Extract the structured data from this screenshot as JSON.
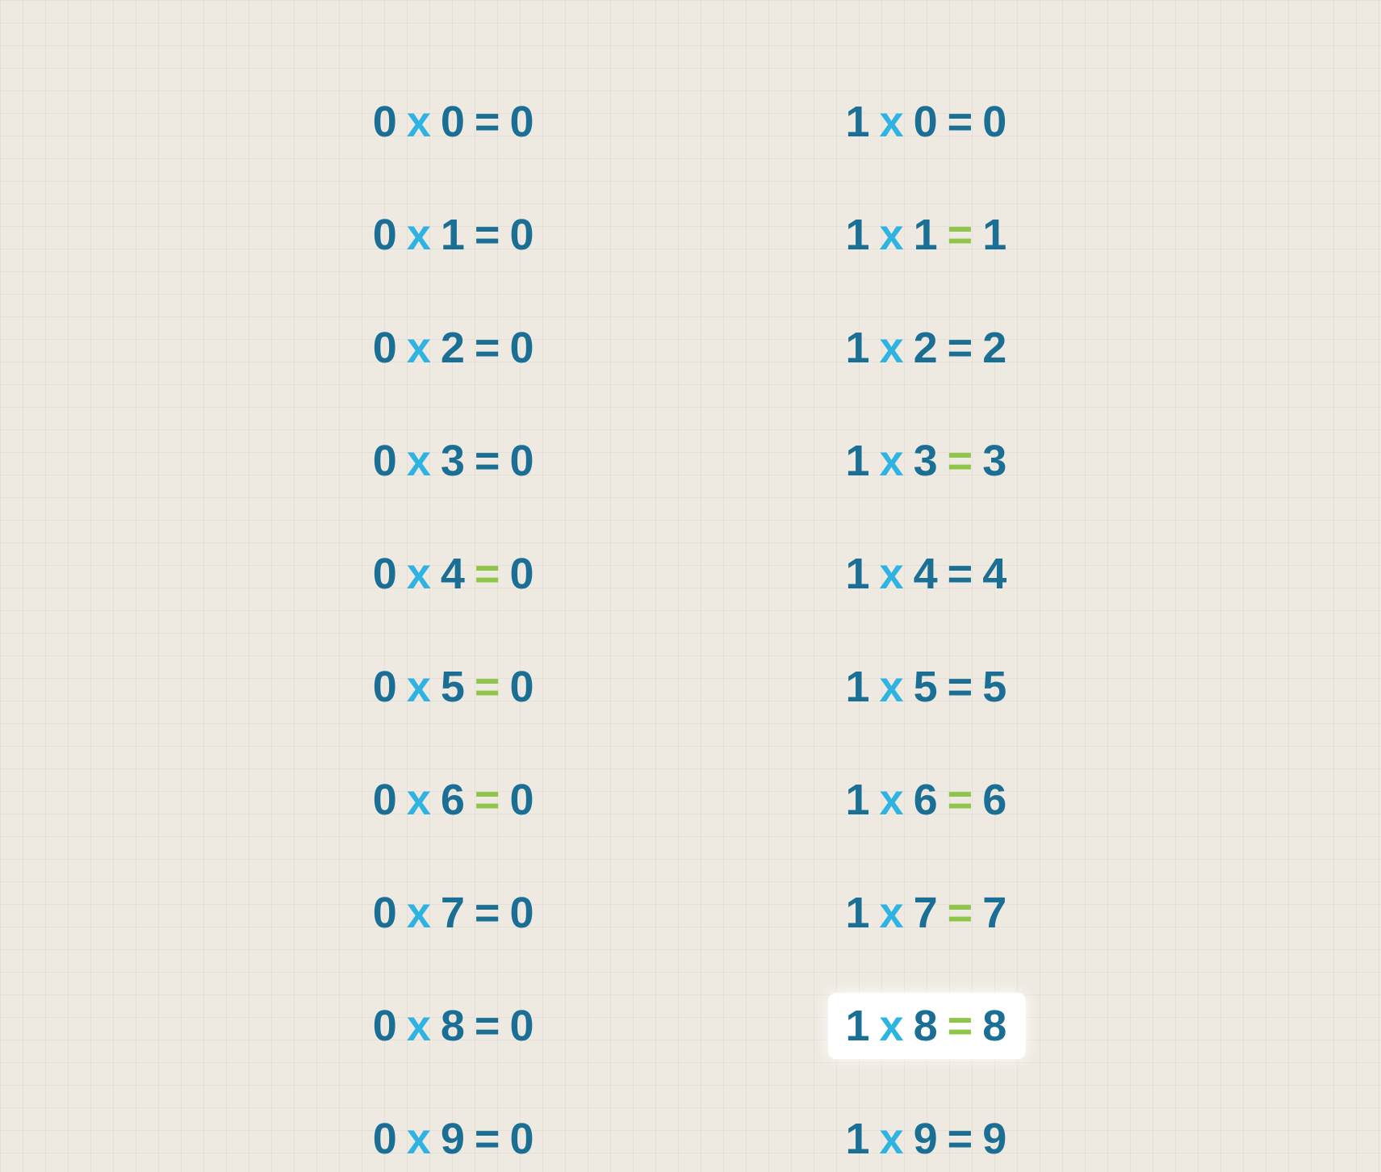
{
  "glyphs": {
    "times": "x",
    "equals": "="
  },
  "columns": [
    {
      "rows": [
        {
          "a": "0",
          "b": "0",
          "r": "0",
          "eq": "teal",
          "hl": false
        },
        {
          "a": "0",
          "b": "1",
          "r": "0",
          "eq": "teal",
          "hl": false
        },
        {
          "a": "0",
          "b": "2",
          "r": "0",
          "eq": "teal",
          "hl": false
        },
        {
          "a": "0",
          "b": "3",
          "r": "0",
          "eq": "teal",
          "hl": false
        },
        {
          "a": "0",
          "b": "4",
          "r": "0",
          "eq": "green",
          "hl": false
        },
        {
          "a": "0",
          "b": "5",
          "r": "0",
          "eq": "green",
          "hl": false
        },
        {
          "a": "0",
          "b": "6",
          "r": "0",
          "eq": "green",
          "hl": false
        },
        {
          "a": "0",
          "b": "7",
          "r": "0",
          "eq": "teal",
          "hl": false
        },
        {
          "a": "0",
          "b": "8",
          "r": "0",
          "eq": "teal",
          "hl": false
        },
        {
          "a": "0",
          "b": "9",
          "r": "0",
          "eq": "teal",
          "hl": false
        }
      ]
    },
    {
      "rows": [
        {
          "a": "1",
          "b": "0",
          "r": "0",
          "eq": "teal",
          "hl": false
        },
        {
          "a": "1",
          "b": "1",
          "r": "1",
          "eq": "green",
          "hl": false
        },
        {
          "a": "1",
          "b": "2",
          "r": "2",
          "eq": "teal",
          "hl": false
        },
        {
          "a": "1",
          "b": "3",
          "r": "3",
          "eq": "green",
          "hl": false
        },
        {
          "a": "1",
          "b": "4",
          "r": "4",
          "eq": "teal",
          "hl": false
        },
        {
          "a": "1",
          "b": "5",
          "r": "5",
          "eq": "teal",
          "hl": false
        },
        {
          "a": "1",
          "b": "6",
          "r": "6",
          "eq": "green",
          "hl": false
        },
        {
          "a": "1",
          "b": "7",
          "r": "7",
          "eq": "green",
          "hl": false
        },
        {
          "a": "1",
          "b": "8",
          "r": "8",
          "eq": "green",
          "hl": true
        },
        {
          "a": "1",
          "b": "9",
          "r": "9",
          "eq": "teal",
          "hl": false
        }
      ]
    }
  ]
}
